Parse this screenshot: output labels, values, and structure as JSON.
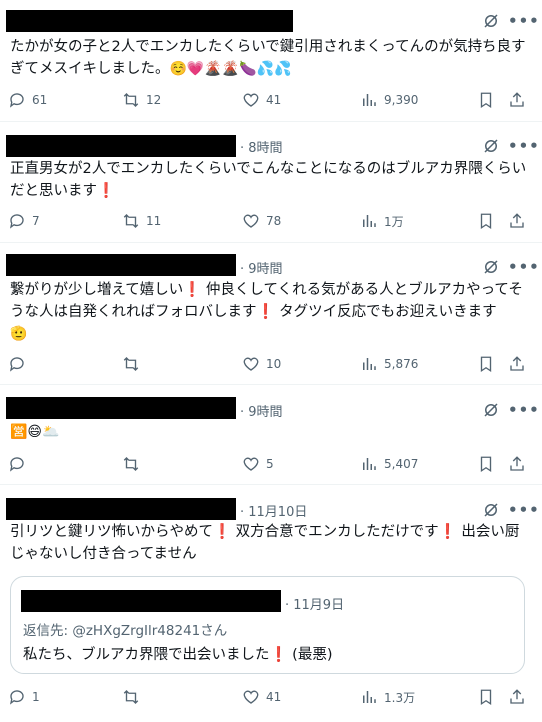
{
  "colors": {
    "text": "#0f1419",
    "muted": "#536471",
    "divider": "#eff3f4",
    "exclaim": "#e0245e"
  },
  "icons": {
    "reply": "reply-icon",
    "repost": "repost-icon",
    "like": "heart-icon",
    "views": "views-icon",
    "bookmark": "bookmark-icon",
    "share": "share-icon",
    "grok": "grok-icon",
    "more": "more-icon"
  },
  "more_label": "•••",
  "posts": [
    {
      "time": "",
      "text": "たかが女の子と2人でエンカしたくらいで鍵引用されまくってんのが気持ち良すぎてメスイキしました。",
      "emojis": "☺️💗🌋🌋🍆💦💦",
      "replies": "61",
      "reposts": "12",
      "likes": "41",
      "views": "9,390"
    },
    {
      "time": "· 8時間",
      "text": "正直男女が2人でエンカしたくらいでこんなことになるのはブルアカ界隈くらいだと思います❗",
      "replies": "7",
      "reposts": "11",
      "likes": "78",
      "views": "1万"
    },
    {
      "time": "· 9時間",
      "text": "繋がりが少し増えて嬉しい❗ 仲良くしてくれる気がある人とブルアカやってそうな人は自発くれればフォロバします❗ タグツイ反応でもお迎えいきます",
      "emojis": "🫡",
      "replies": "",
      "reposts": "",
      "likes": "10",
      "views": "5,876"
    },
    {
      "time": "· 9時間",
      "text": "",
      "emojis": "🈺😄🌥️",
      "replies": "",
      "reposts": "",
      "likes": "5",
      "views": "5,407"
    },
    {
      "time": "· 11月10日",
      "text": "引リツと鍵リツ怖いからやめて❗ 双方合意でエンカしただけです❗ 出会い厨じゃないし付き合ってません",
      "quote": {
        "time": "· 11月9日",
        "reply_to": "返信先: @zHXgZrgIlr48241さん",
        "text": "私たち、ブルアカ界隈で出会いました❗ (最悪)"
      },
      "replies": "1",
      "reposts": "",
      "likes": "41",
      "views": "1.3万"
    }
  ]
}
